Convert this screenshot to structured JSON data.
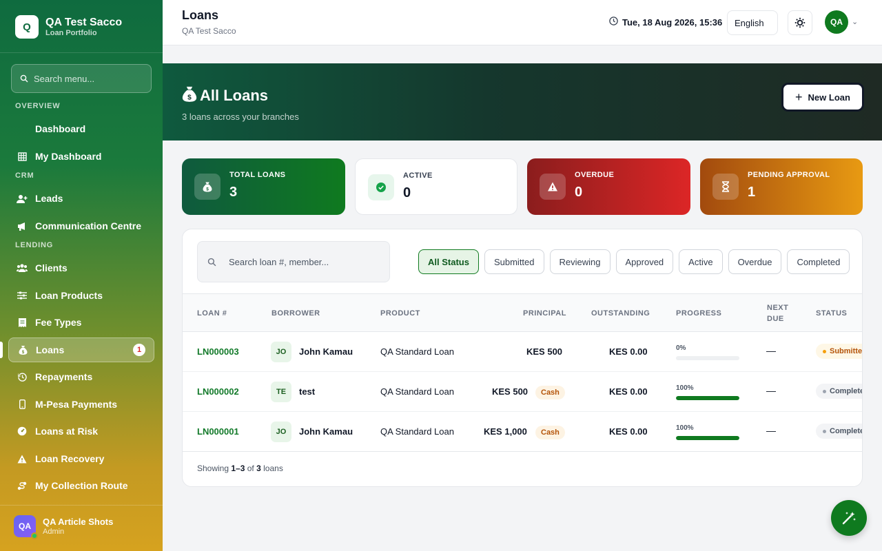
{
  "sidebar": {
    "brand_initial": "Q",
    "brand_name": "QA Test Sacco",
    "brand_sub": "Loan Portfolio",
    "search_placeholder": "Search menu...",
    "sections": {
      "overview": "OVERVIEW",
      "crm": "CRM",
      "lending": "LENDING"
    },
    "items": [
      {
        "label": "Dashboard",
        "icon": "none"
      },
      {
        "label": "My Dashboard",
        "icon": "grid-icon"
      },
      {
        "label": "Leads",
        "icon": "user-plus-icon"
      },
      {
        "label": "Communication Centre",
        "icon": "megaphone-icon"
      },
      {
        "label": "Clients",
        "icon": "users-icon"
      },
      {
        "label": "Loan Products",
        "icon": "sliders-icon"
      },
      {
        "label": "Fee Types",
        "icon": "receipt-icon"
      },
      {
        "label": "Loans",
        "icon": "money-bag-icon",
        "badge": "1"
      },
      {
        "label": "Repayments",
        "icon": "history-icon"
      },
      {
        "label": "M-Pesa Payments",
        "icon": "phone-icon"
      },
      {
        "label": "Loans at Risk",
        "icon": "gauge-icon"
      },
      {
        "label": "Loan Recovery",
        "icon": "warning-icon"
      },
      {
        "label": "My Collection Route",
        "icon": "route-icon"
      }
    ],
    "user": {
      "initials": "QA",
      "name": "QA Article Shots",
      "role": "Admin"
    }
  },
  "topbar": {
    "title": "Loans",
    "subtitle": "QA Test Sacco",
    "datetime": "Tue, 18 Aug 2026, 15:36",
    "language": "English",
    "avatar": "QA"
  },
  "hero": {
    "title": "All Loans",
    "subtitle": "3 loans across your branches",
    "new_button": "New Loan"
  },
  "stats": [
    {
      "label": "TOTAL LOANS",
      "value": "3",
      "icon": "money-bag-icon"
    },
    {
      "label": "ACTIVE",
      "value": "0",
      "icon": "check-circle-icon"
    },
    {
      "label": "OVERDUE",
      "value": "0",
      "icon": "warning-icon"
    },
    {
      "label": "PENDING APPROVAL",
      "value": "1",
      "icon": "hourglass-icon"
    }
  ],
  "table": {
    "search_placeholder": "Search loan #, member...",
    "filters": [
      "All Status",
      "Submitted",
      "Reviewing",
      "Approved",
      "Active",
      "Overdue",
      "Completed"
    ],
    "headers": {
      "loan_no": "LOAN #",
      "borrower": "BORROWER",
      "product": "PRODUCT",
      "principal": "PRINCIPAL",
      "outstanding": "OUTSTANDING",
      "progress": "PROGRESS",
      "next_due_1": "NEXT",
      "next_due_2": "DUE",
      "status": "STATUS"
    },
    "rows": [
      {
        "loan_no": "LN000003",
        "initials": "JO",
        "borrower": "John Kamau",
        "product": "QA Standard Loan",
        "principal": "KES 500",
        "method": "",
        "outstanding": "KES 0.00",
        "progress_label": "0%",
        "progress": 0,
        "next_due": "—",
        "status": "Submitted"
      },
      {
        "loan_no": "LN000002",
        "initials": "TE",
        "borrower": "test",
        "product": "QA Standard Loan",
        "principal": "KES 500",
        "method": "Cash",
        "outstanding": "KES 0.00",
        "progress_label": "100%",
        "progress": 1,
        "next_due": "—",
        "status": "Complete"
      },
      {
        "loan_no": "LN000001",
        "initials": "JO",
        "borrower": "John Kamau",
        "product": "QA Standard Loan",
        "principal": "KES 1,000",
        "method": "Cash",
        "outstanding": "KES 0.00",
        "progress_label": "100%",
        "progress": 1,
        "next_due": "—",
        "status": "Complete"
      }
    ],
    "footer": {
      "prefix": "Showing",
      "range": "1–3",
      "of": "of",
      "total": "3",
      "suffix": "loans"
    }
  },
  "colors": {
    "brand_green": "#0f7a1f",
    "overdue_red": "#dc2626",
    "pending_orange": "#e89a12"
  }
}
